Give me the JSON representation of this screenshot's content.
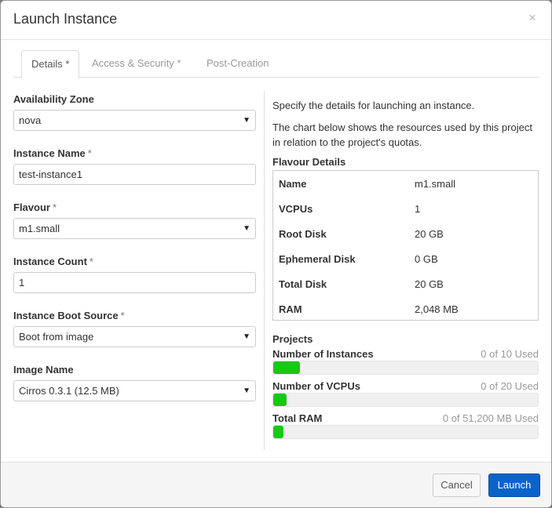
{
  "modal": {
    "title": "Launch Instance",
    "close_symbol": "×"
  },
  "tabs": [
    {
      "label": "Details *",
      "active": true
    },
    {
      "label": "Access & Security *",
      "active": false
    },
    {
      "label": "Post-Creation",
      "active": false
    }
  ],
  "form": {
    "required_marker": "*",
    "availability_zone": {
      "label": "Availability Zone",
      "value": "nova"
    },
    "instance_name": {
      "label": "Instance Name",
      "value": "test-instance1"
    },
    "flavour": {
      "label": "Flavour",
      "value": "m1.small"
    },
    "instance_count": {
      "label": "Instance Count",
      "value": "1"
    },
    "boot_source": {
      "label": "Instance Boot Source",
      "value": "Boot from image"
    },
    "image_name": {
      "label": "Image Name",
      "value": "Cirros 0.3.1 (12.5 MB)"
    }
  },
  "help": {
    "intro": "Specify the details for launching an instance.",
    "chart_note": "The chart below shows the resources used by this project in relation to the project's quotas."
  },
  "flavour_details": {
    "title": "Flavour Details",
    "rows": [
      {
        "key": "Name",
        "value": "m1.small"
      },
      {
        "key": "VCPUs",
        "value": "1"
      },
      {
        "key": "Root Disk",
        "value": "20 GB"
      },
      {
        "key": "Ephemeral Disk",
        "value": "0 GB"
      },
      {
        "key": "Total Disk",
        "value": "20 GB"
      },
      {
        "key": "RAM",
        "value": "2,048 MB"
      }
    ]
  },
  "projects": {
    "title": "Projects",
    "quotas": [
      {
        "label": "Number of Instances",
        "used_text": "0 of 10 Used",
        "fill_fraction": 0.1
      },
      {
        "label": "Number of VCPUs",
        "used_text": "0 of 20 Used",
        "fill_fraction": 0.05
      },
      {
        "label": "Total RAM",
        "used_text": "0 of 51,200 MB Used",
        "fill_fraction": 0.04
      }
    ]
  },
  "footer": {
    "cancel_label": "Cancel",
    "launch_label": "Launch"
  },
  "colors": {
    "primary": "#0a63c9",
    "quota_fill": "#16c916"
  }
}
